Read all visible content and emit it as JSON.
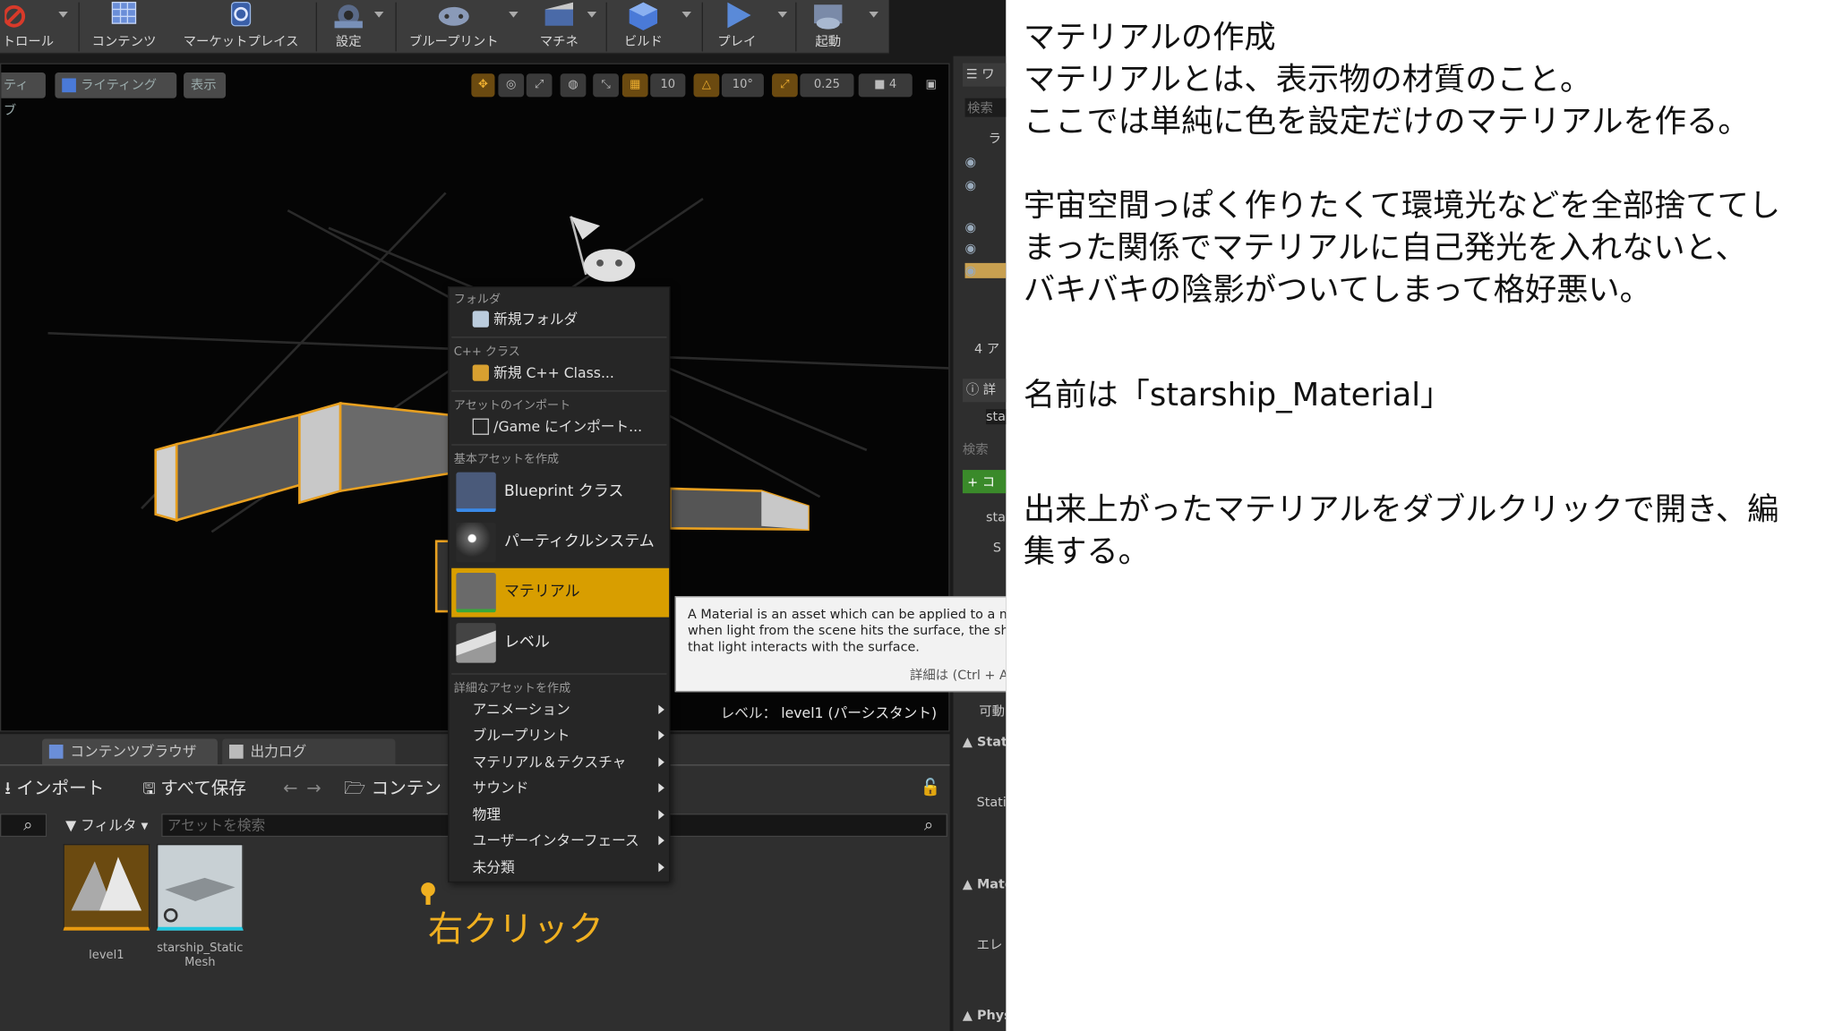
{
  "toolbar": {
    "items": [
      {
        "label": "トロール",
        "icon": "no-entry-icon"
      },
      {
        "label": "コンテンツ",
        "icon": "content-icon"
      },
      {
        "label": "マーケットプレイス",
        "icon": "marketplace-icon"
      },
      {
        "label": "設定",
        "icon": "settings-icon"
      },
      {
        "label": "ブループリント",
        "icon": "blueprint-icon"
      },
      {
        "label": "マチネ",
        "icon": "matinee-icon"
      },
      {
        "label": "ビルド",
        "icon": "build-icon"
      },
      {
        "label": "プレイ",
        "icon": "play-icon"
      },
      {
        "label": "起動",
        "icon": "launch-icon"
      }
    ]
  },
  "viewport": {
    "mode_tab": "ティブ",
    "lighting_tab": "ライティング",
    "show_tab": "表示",
    "grid_value": "10",
    "angle_value": "10°",
    "scale_value": "0.25",
    "camera_speed": "4",
    "level_prefix": "レベル：",
    "level_name": "level1 (パーシスタント)"
  },
  "context_menu": {
    "sec_folder": "フォルダ",
    "new_folder": "新規フォルダ",
    "sec_cpp": "C++ クラス",
    "new_cpp": "新規 C++ Class...",
    "sec_import": "アセットのインポート",
    "import_game": "/Game にインポート...",
    "sec_basic": "基本アセットを作成",
    "blueprint_class": "Blueprint クラス",
    "particle_system": "パーティクルシステム",
    "material": "マテリアル",
    "level": "レベル",
    "sec_advanced": "詳細なアセットを作成",
    "sub_items": [
      "アニメーション",
      "ブループリント",
      "マテリアル＆テクスチャ",
      "サウンド",
      "物理",
      "ユーザーインターフェース",
      "未分類"
    ]
  },
  "tooltip": {
    "line1": "A Material is an asset which can be applied to a m",
    "line2": "when light from the scene hits the surface, the sha",
    "line3": "that light interacts with the surface.",
    "more": "詳細は (Ctrl + A"
  },
  "content_browser": {
    "tab_browser": "コンテンツブラウザ",
    "tab_output": "出力ログ",
    "import_btn": "インポート",
    "save_all_btn": "すべて保存",
    "path_btn": "コンテン",
    "filter_btn": "フィルタ",
    "search_placeholder": "アセットを検索",
    "assets": [
      {
        "name": "level1"
      },
      {
        "name": "starship_Static Mesh"
      }
    ]
  },
  "right_panel": {
    "search1": "検索",
    "tab_top": "ワ",
    "label_ra": "ラ",
    "actor_count": "4 ア",
    "details_tab": "詳",
    "sta1": "sta",
    "search2": "検索",
    "add_btn": "+ コ",
    "sta2": "sta",
    "s_item": "S",
    "movable": "可動",
    "stat1": "Stat",
    "stat2": "Stati",
    "mate": "Mate",
    "ele": "エレ",
    "phys": "Phys"
  },
  "annotation": {
    "right_click": "右クリック"
  },
  "notes": {
    "heading": "マテリアルの作成",
    "p1": "マテリアルとは、表示物の材質のこと。\nここでは単純に色を設定だけのマテリアルを作る。",
    "p2": "宇宙空間っぽく作りたくて環境光などを全部捨ててし\nまった関係でマテリアルに自己発光を入れないと、\nバキバキの陰影がついてしまって格好悪い。",
    "p3": "名前は「starship_Material」",
    "p4": "出来上がったマテリアルをダブルクリックで開き、編\n集する。"
  },
  "colors": {
    "accent": "#d89e00",
    "annotation_yellow": "#f0b020",
    "editor_bg": "#1a1a1a"
  }
}
